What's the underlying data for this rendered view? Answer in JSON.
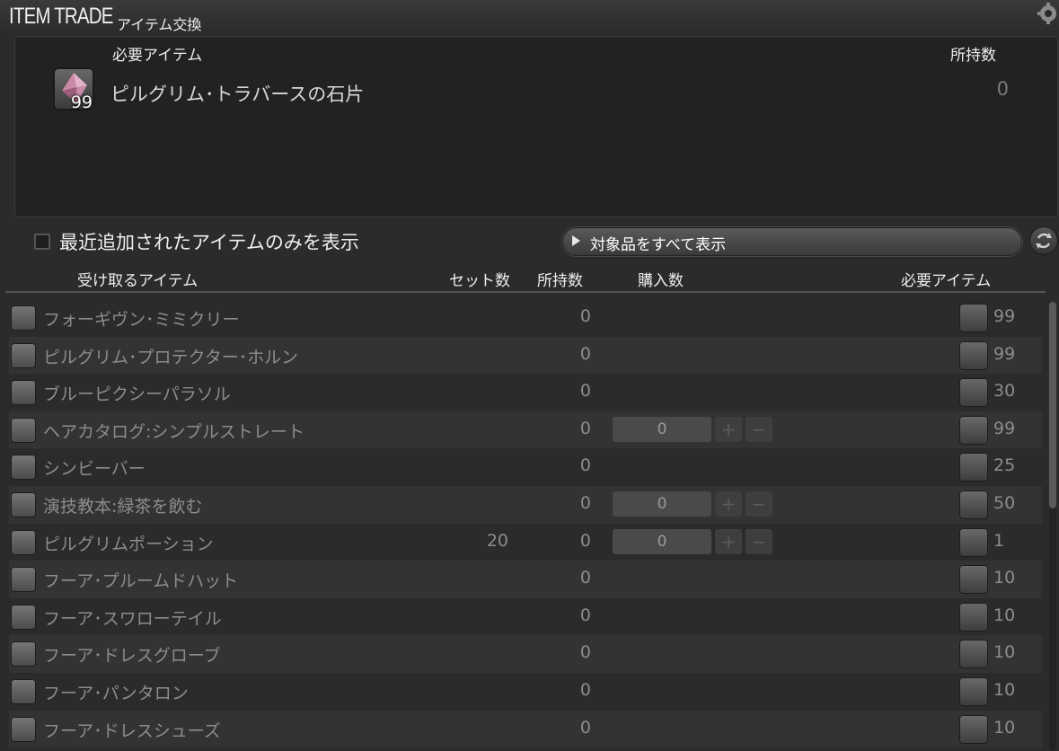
{
  "window": {
    "title_en": "ITEM TRADE",
    "title_jp": "アイテム交換"
  },
  "required": {
    "label": "必要アイテム",
    "owned_label": "所持数",
    "item_name": "ピルグリム･トラバースの石片",
    "item_qty": "99",
    "owned": "0",
    "icon": "crystal-shard-icon"
  },
  "filter": {
    "checkbox_label": "最近追加されたアイテムのみを表示",
    "checked": false,
    "show_all_label": "対象品をすべて表示"
  },
  "columns": {
    "receive": "受け取るアイテム",
    "set_count": "セット数",
    "owned": "所持数",
    "purchase": "購入数",
    "required": "必要アイテム"
  },
  "colors": {
    "background": "#2b2b2b",
    "row_alt": "#333333",
    "text_dim": "#8c8c8c",
    "text_bright": "#eeeeee"
  },
  "items": [
    {
      "name": "フォーギヴン･ミミクリー",
      "set": "",
      "owned": "0",
      "purchase": null,
      "cost": "99",
      "icon": "star-icon",
      "cost_icon": "crystal-shard-icon"
    },
    {
      "name": "ピルグリム･プロテクター･ホルン",
      "set": "",
      "owned": "0",
      "purchase": null,
      "cost": "99",
      "icon": "star-icon",
      "cost_icon": "crystal-shard-icon"
    },
    {
      "name": "ブルーピクシーパラソル",
      "set": "",
      "owned": "0",
      "purchase": null,
      "cost": "30",
      "icon": "chest-icon",
      "cost_icon": "crystal-shard-icon"
    },
    {
      "name": "ヘアカタログ:シンプルストレート",
      "set": "",
      "owned": "0",
      "purchase": "0",
      "cost": "99",
      "icon": "chest-icon",
      "cost_icon": "potion-flask-icon"
    },
    {
      "name": "シンビーバー",
      "set": "",
      "owned": "0",
      "purchase": null,
      "cost": "25",
      "icon": "minion-icon",
      "cost_icon": "potion-flask-icon"
    },
    {
      "name": "演技教本:緑茶を飲む",
      "set": "",
      "owned": "0",
      "purchase": "0",
      "cost": "50",
      "icon": "chest-icon",
      "cost_icon": "feather-scale-icon"
    },
    {
      "name": "ピルグリムポーション",
      "set": "20",
      "owned": "0",
      "purchase": "0",
      "cost": "1",
      "icon": "potion-icon",
      "cost_icon": "feather-scale-icon"
    },
    {
      "name": "フーア･プルームドハット",
      "set": "",
      "owned": "0",
      "purchase": null,
      "cost": "10",
      "icon": "hat-icon",
      "cost_icon": "feather-scale-icon"
    },
    {
      "name": "フーア･スワローテイル",
      "set": "",
      "owned": "0",
      "purchase": null,
      "cost": "10",
      "icon": "body-armor-icon",
      "cost_icon": "feather-scale-icon"
    },
    {
      "name": "フーア･ドレスグローブ",
      "set": "",
      "owned": "0",
      "purchase": null,
      "cost": "10",
      "icon": "glove-icon",
      "cost_icon": "feather-scale-icon"
    },
    {
      "name": "フーア･パンタロン",
      "set": "",
      "owned": "0",
      "purchase": null,
      "cost": "10",
      "icon": "legs-icon",
      "cost_icon": "feather-scale-icon"
    },
    {
      "name": "フーア･ドレスシューズ",
      "set": "",
      "owned": "0",
      "purchase": null,
      "cost": "10",
      "icon": "boots-icon",
      "cost_icon": "feather-scale-icon"
    }
  ]
}
